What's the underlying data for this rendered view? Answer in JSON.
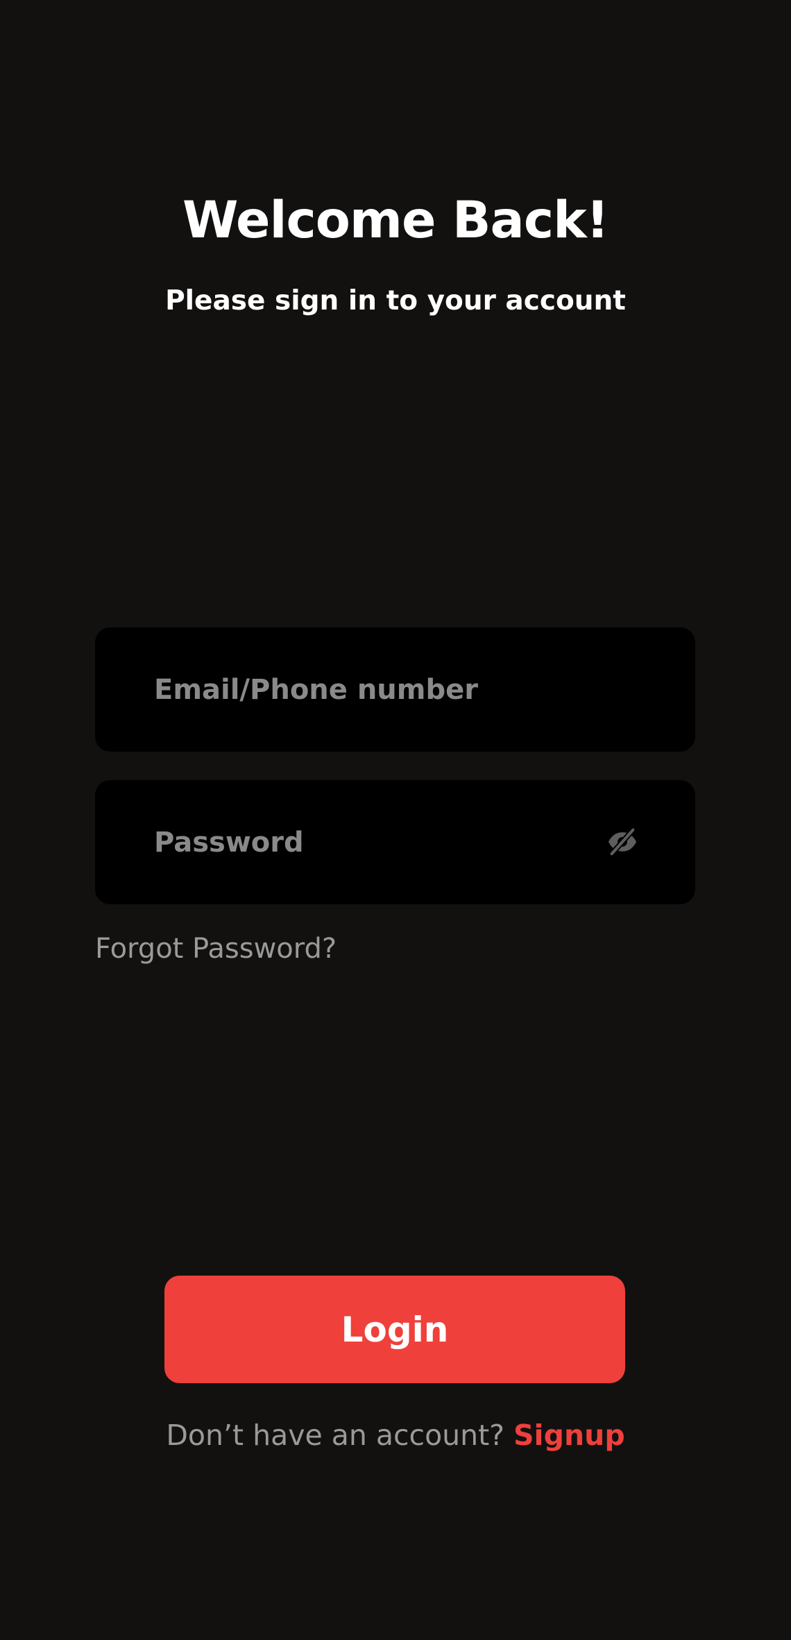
{
  "header": {
    "title": "Welcome Back!",
    "subtitle": "Please sign in to your account"
  },
  "form": {
    "email": {
      "placeholder": "Email/Phone number",
      "value": ""
    },
    "password": {
      "placeholder": "Password",
      "value": "",
      "toggle_icon": "eye-slash-icon"
    },
    "forgot_password_label": "Forgot Password?"
  },
  "actions": {
    "login_label": "Login",
    "signup_prompt": "Don’t have an account?",
    "signup_label": "Signup"
  },
  "colors": {
    "background": "#121110",
    "field_background": "#000000",
    "accent": "#ef403c",
    "muted_text": "#9a9a9a",
    "primary_text": "#ffffff"
  }
}
